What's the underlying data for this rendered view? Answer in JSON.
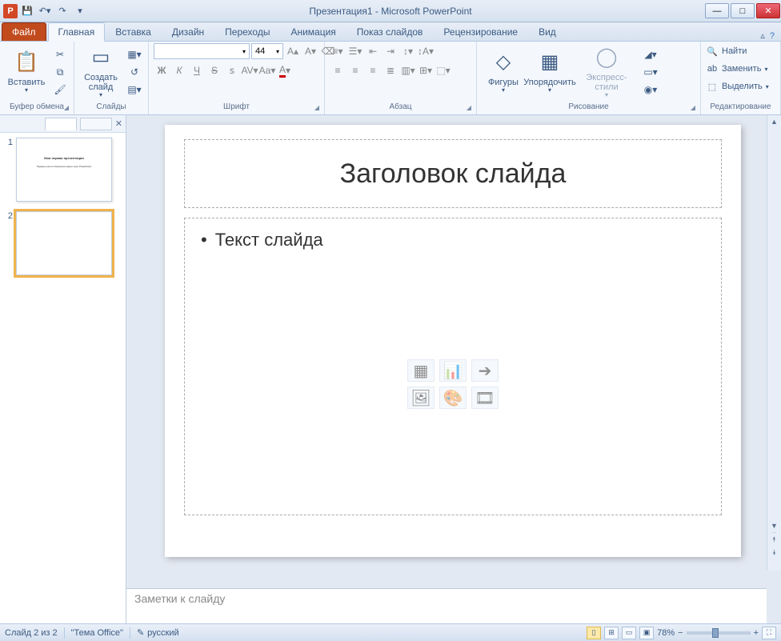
{
  "title": "Презентация1 - Microsoft PowerPoint",
  "qat": {
    "app_letter": "P"
  },
  "tabs": {
    "file": "Файл",
    "items": [
      "Главная",
      "Вставка",
      "Дизайн",
      "Переходы",
      "Анимация",
      "Показ слайдов",
      "Рецензирование",
      "Вид"
    ],
    "active_index": 0
  },
  "ribbon": {
    "clipboard": {
      "paste": "Вставить",
      "label": "Буфер обмена"
    },
    "slides": {
      "new_slide": "Создать слайд",
      "label": "Слайды"
    },
    "font": {
      "size": "44",
      "label": "Шрифт"
    },
    "paragraph": {
      "label": "Абзац"
    },
    "drawing": {
      "shapes": "Фигуры",
      "arrange": "Упорядочить",
      "styles": "Экспресс-стили",
      "label": "Рисование"
    },
    "editing": {
      "find": "Найти",
      "replace": "Заменить",
      "select": "Выделить",
      "label": "Редактирование"
    }
  },
  "thumbnails": {
    "slides": [
      {
        "num": "1",
        "title": "Моя первая презентация",
        "sub": "Первые шаги в Освоении новых окон PowerPoint"
      },
      {
        "num": "2",
        "title": "",
        "sub": ""
      }
    ],
    "selected_index": 1
  },
  "slide": {
    "title_placeholder": "Заголовок слайда",
    "body_placeholder": "Текст слайда"
  },
  "notes": {
    "placeholder": "Заметки к слайду"
  },
  "status": {
    "slide_info": "Слайд 2 из 2",
    "theme": "\"Тема Office\"",
    "language": "русский",
    "zoom": "78%"
  }
}
